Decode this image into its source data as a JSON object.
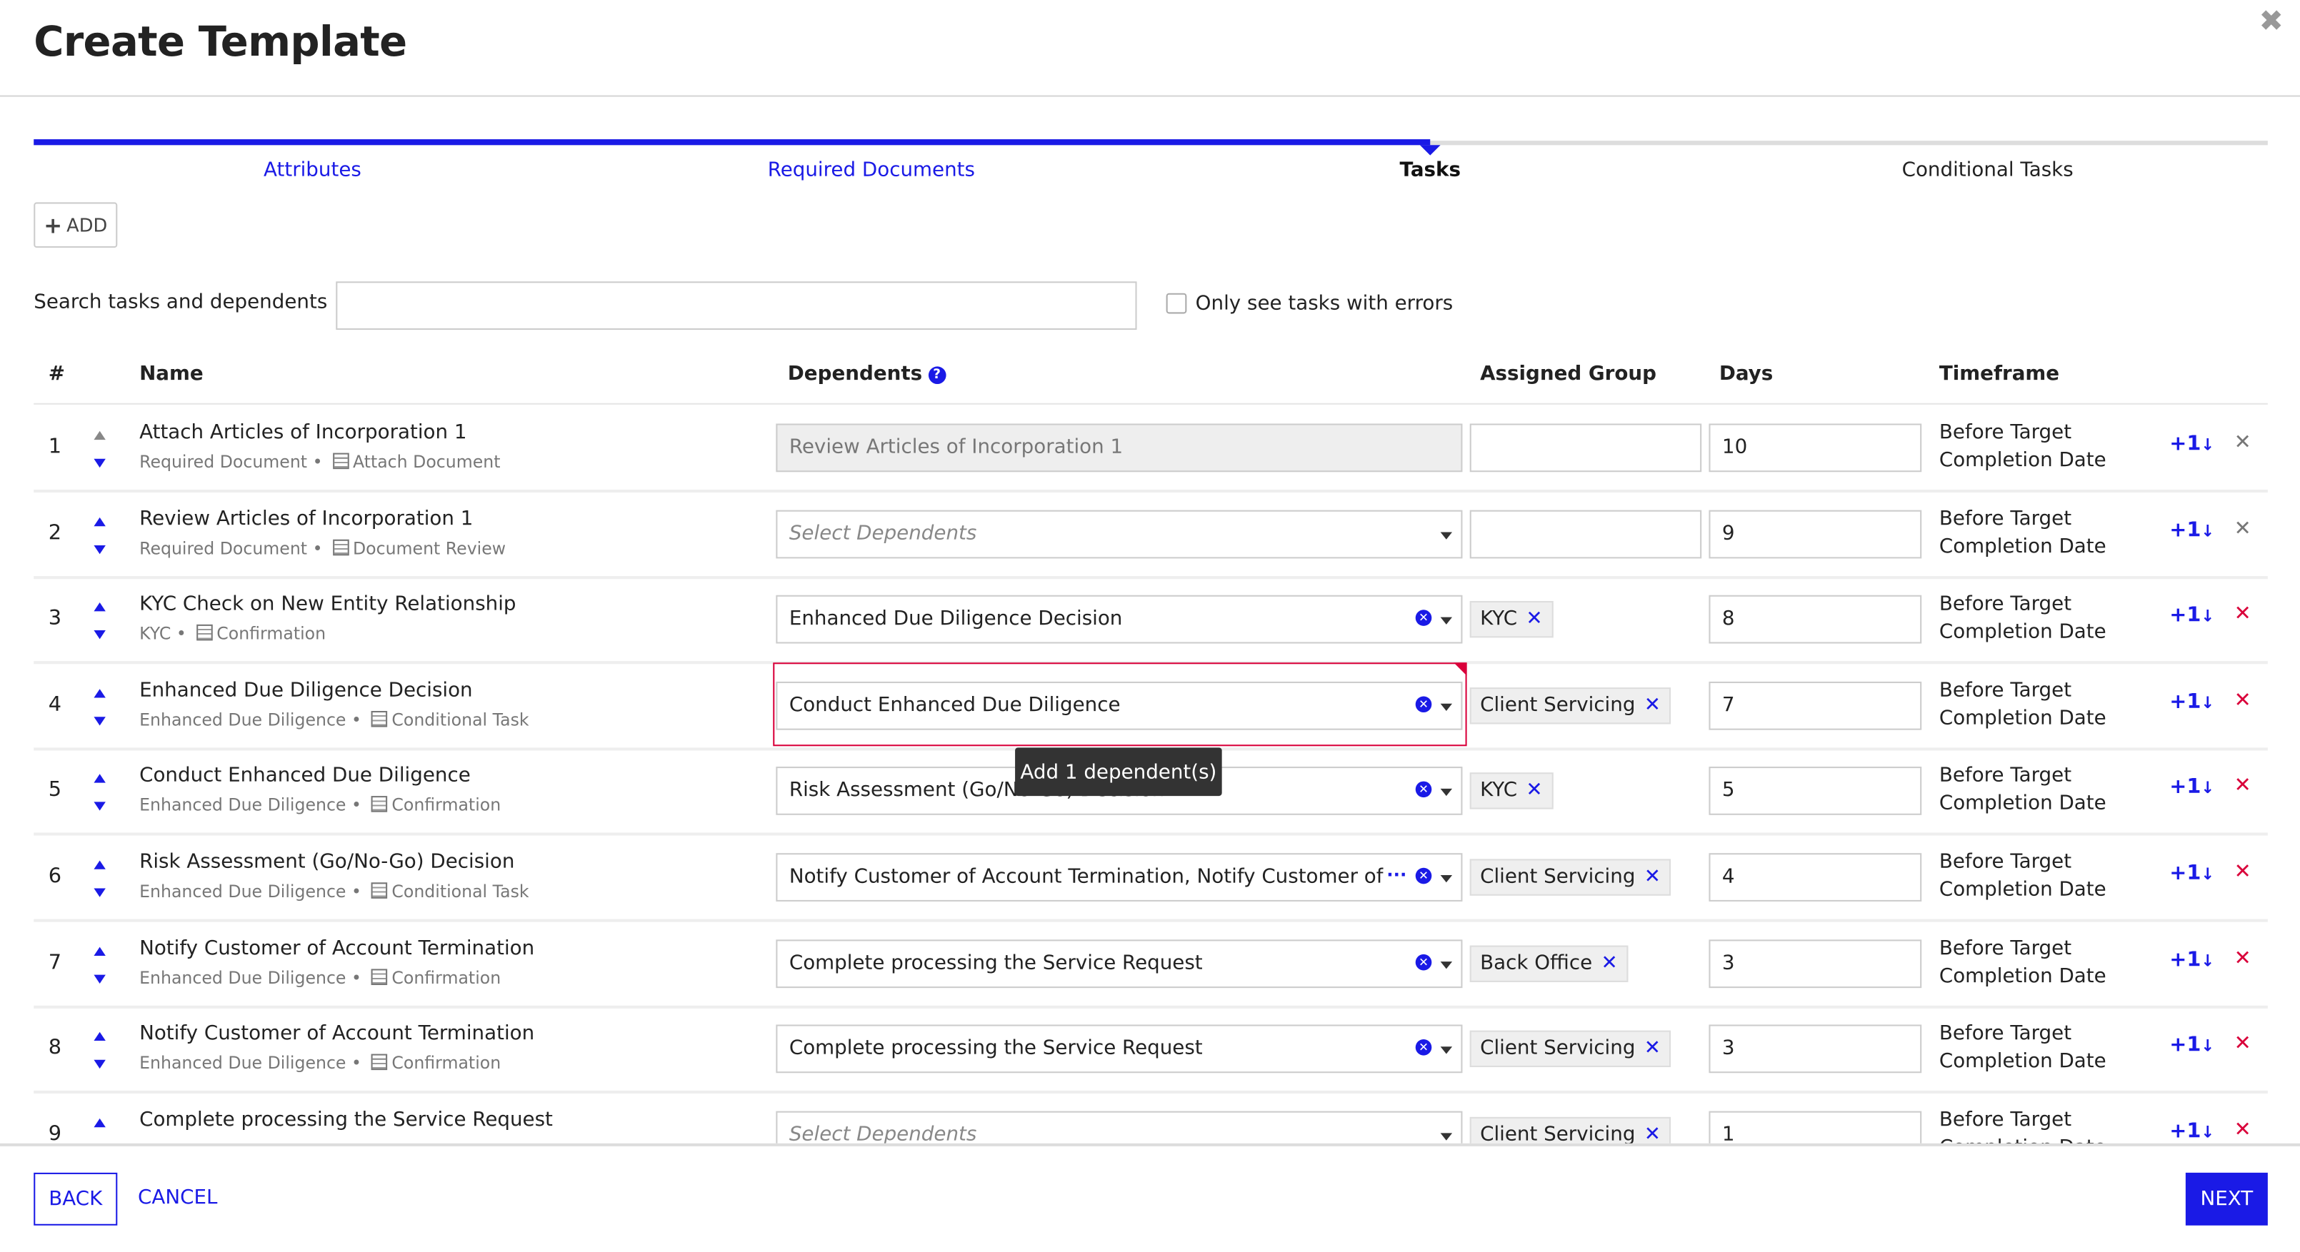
{
  "title": "Create Template",
  "close_icon": "close-icon",
  "accent_color": "#1a1ae6",
  "error_color": "#d9003a",
  "steps": [
    {
      "label": "Attributes",
      "state": "done"
    },
    {
      "label": "Required Documents",
      "state": "done"
    },
    {
      "label": "Tasks",
      "state": "active"
    },
    {
      "label": "Conditional Tasks",
      "state": "future"
    }
  ],
  "toolbar": {
    "add_label": "ADD"
  },
  "search": {
    "label": "Search tasks and dependents",
    "value": "",
    "errors_only_label": "Only see tasks with errors",
    "errors_only_checked": false
  },
  "columns": {
    "num": "#",
    "name": "Name",
    "dependents": "Dependents",
    "group": "Assigned Group",
    "days": "Days",
    "timeframe": "Timeframe"
  },
  "rows": [
    {
      "num": "1",
      "name": "Attach Articles of Incorporation 1",
      "category": "Required Document",
      "type": "Attach Document",
      "dependents": "Review Articles of Incorporation 1",
      "dep_state": "disabled",
      "group": "",
      "days": "10",
      "timeframe": [
        "Before Target",
        "Completion Date"
      ],
      "plus": "+1",
      "up_disabled": true,
      "del_gray": true
    },
    {
      "num": "2",
      "name": "Review Articles of Incorporation 1",
      "category": "Required Document",
      "type": "Document Review",
      "dependents": "Select Dependents",
      "dep_state": "placeholder",
      "group": "",
      "days": "9",
      "timeframe": [
        "Before Target",
        "Completion Date"
      ],
      "plus": "+1",
      "del_gray": true
    },
    {
      "num": "3",
      "name": "KYC Check on New Entity Relationship",
      "category": "KYC",
      "type": "Confirmation",
      "dependents": "Enhanced Due Diligence Decision",
      "dep_state": "value",
      "group": "KYC",
      "days": "8",
      "timeframe": [
        "Before Target",
        "Completion Date"
      ],
      "plus": "+1"
    },
    {
      "num": "4",
      "name": "Enhanced Due Diligence Decision",
      "category": "Enhanced Due Diligence",
      "type": "Conditional Task",
      "dependents": "Conduct Enhanced Due Diligence",
      "dep_state": "value",
      "error": true,
      "group": "Client Servicing",
      "days": "7",
      "timeframe": [
        "Before Target",
        "Completion Date"
      ],
      "plus": "+1"
    },
    {
      "num": "5",
      "name": "Conduct Enhanced Due Diligence",
      "category": "Enhanced Due Diligence",
      "type": "Confirmation",
      "dependents": "Risk Assessment (Go/No-Go) Decision",
      "dep_state": "value",
      "group": "KYC",
      "days": "5",
      "timeframe": [
        "Before Target",
        "Completion Date"
      ],
      "plus": "+1"
    },
    {
      "num": "6",
      "name": "Risk Assessment (Go/No-Go) Decision",
      "category": "Enhanced Due Diligence",
      "type": "Conditional Task",
      "dependents": "Notify Customer of Account Termination, Notify Customer of Account",
      "dep_state": "value",
      "more": true,
      "group": "Client Servicing",
      "days": "4",
      "timeframe": [
        "Before Target",
        "Completion Date"
      ],
      "plus": "+1"
    },
    {
      "num": "7",
      "name": "Notify Customer of Account Termination",
      "category": "Enhanced Due Diligence",
      "type": "Confirmation",
      "dependents": "Complete processing the Service Request",
      "dep_state": "value",
      "group": "Back Office",
      "days": "3",
      "timeframe": [
        "Before Target",
        "Completion Date"
      ],
      "plus": "+1"
    },
    {
      "num": "8",
      "name": "Notify Customer of Account Termination",
      "category": "Enhanced Due Diligence",
      "type": "Confirmation",
      "dependents": "Complete processing the Service Request",
      "dep_state": "value",
      "group": "Client Servicing",
      "days": "3",
      "timeframe": [
        "Before Target",
        "Completion Date"
      ],
      "plus": "+1"
    },
    {
      "num": "9",
      "name": "Complete processing the Service Request",
      "category": "",
      "type": "",
      "dependents": "Select Dependents",
      "dep_state": "placeholder",
      "group": "Client Servicing",
      "days": "1",
      "timeframe": [
        "Before Target",
        "Completion Date"
      ],
      "plus": "+1"
    }
  ],
  "tooltip": "Add 1 dependent(s)",
  "footer": {
    "back_label": "BACK",
    "cancel_label": "CANCEL",
    "next_label": "NEXT"
  }
}
